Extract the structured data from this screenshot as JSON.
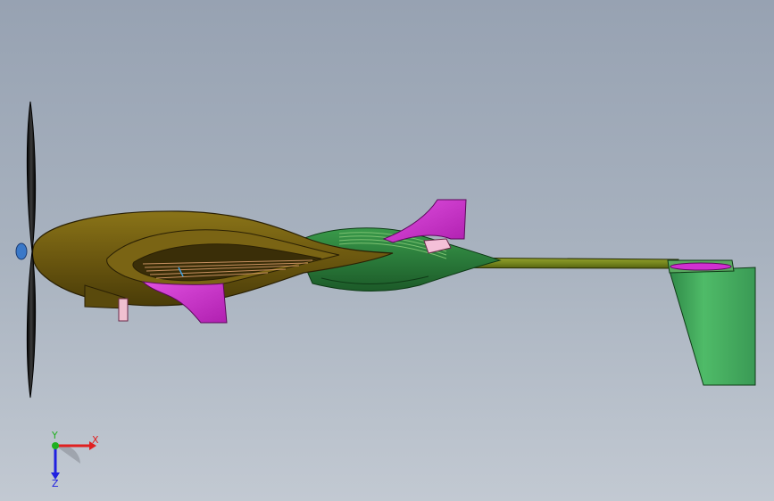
{
  "viewport": {
    "background_top": "#97a2b2",
    "background_bottom": "#c2c9d2"
  },
  "model": {
    "fuselage_color": "#6e5a10",
    "fairing_color": "#2a7a3a",
    "fin_color": "#d030d0",
    "rudder_color": "#3fa35a",
    "boom_color": "#7a8a20",
    "propeller_color": "#1a1a1a"
  },
  "triad": {
    "x_label": "X",
    "y_label": "Y",
    "z_label": "Z",
    "x_color": "#e02020",
    "y_color": "#20b020",
    "z_color": "#2020e0"
  }
}
